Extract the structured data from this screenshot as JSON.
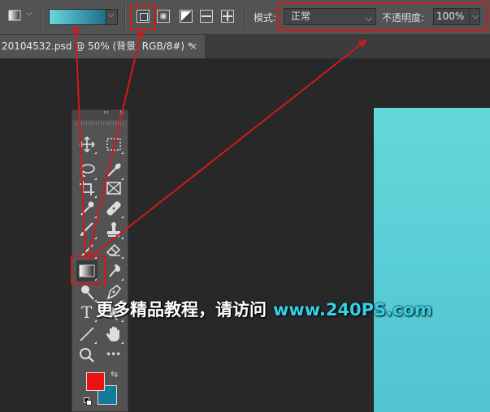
{
  "options_bar": {
    "tool_icon": "gradient-tool-icon",
    "gradient_picker": {
      "from_color": "#69d6df",
      "to_color": "#1e6e87"
    },
    "gradient_types": [
      "linear-gradient-icon",
      "radial-gradient-icon",
      "angle-gradient-icon",
      "reflected-gradient-icon",
      "diamond-gradient-icon"
    ],
    "selected_gradient_type": "linear-gradient-icon",
    "mode_label": "模式:",
    "mode_value": "正常",
    "opacity_label": "不透明度:",
    "opacity_value": "100%"
  },
  "document_tab": {
    "title": "20104532.psd @ 50% (背景, RGB/8#) *",
    "close_glyph": "×"
  },
  "toolbox": {
    "header_glyph_left": "‹‹",
    "header_glyph_right": "×",
    "tools": [
      "move-icon",
      "marquee-icon",
      "lasso-icon",
      "quick-select-icon",
      "crop-icon",
      "frame-icon",
      "eyedropper-icon",
      "healing-brush-icon",
      "brush-icon",
      "stamp-icon",
      "history-brush-icon",
      "eraser-icon",
      "gradient-icon",
      "blur-icon",
      "dodge-icon",
      "pen-icon",
      "type-icon",
      "path-select-icon",
      "line-icon",
      "hand-icon",
      "zoom-icon",
      "more-icon"
    ],
    "more_glyph": "•••",
    "type_glyph": "T",
    "foreground_color": "#ee1111",
    "background_color": "#137a9a"
  },
  "canvas": {
    "color_top": "#62d8da",
    "color_bottom": "#50c4d1"
  },
  "watermark": {
    "text": "更多精品教程，请访问",
    "url": "www.240PS.com"
  },
  "annotation_color": "#d01a1a"
}
